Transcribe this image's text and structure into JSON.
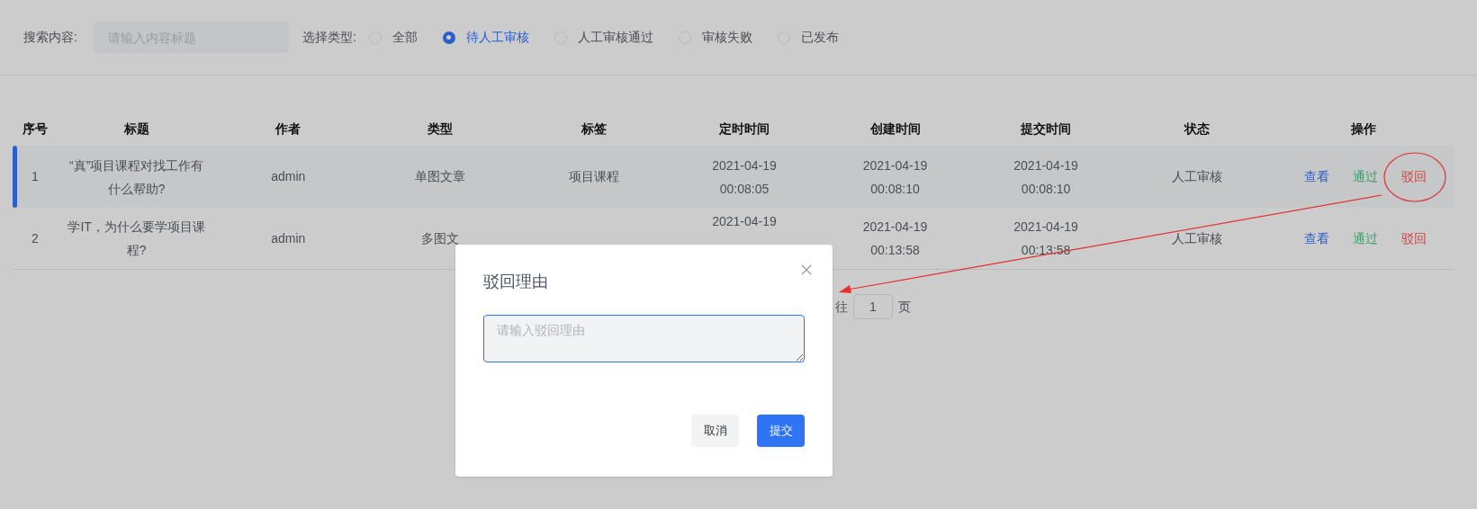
{
  "filter": {
    "search": {
      "label": "搜索内容:",
      "placeholder": "请输入内容标题"
    },
    "type": {
      "label": "选择类型:",
      "options": [
        {
          "label": "全部",
          "selected": false
        },
        {
          "label": "待人工审核",
          "selected": true
        },
        {
          "label": "人工审核通过",
          "selected": false
        },
        {
          "label": "审核失败",
          "selected": false
        },
        {
          "label": "已发布",
          "selected": false
        }
      ]
    }
  },
  "table": {
    "columns": [
      "序号",
      "标题",
      "作者",
      "类型",
      "标签",
      "定时时间",
      "创建时间",
      "提交时间",
      "状态",
      "操作"
    ],
    "rows": [
      {
        "selected": true,
        "index": "1",
        "title": "“真”项目课程对找工作有什么帮助?",
        "author": "admin",
        "type": "单图文章",
        "tag": "项目课程",
        "scheduled": [
          "2021-04-19",
          "00:08:05"
        ],
        "created": [
          "2021-04-19",
          "00:08:10"
        ],
        "submitted": [
          "2021-04-19",
          "00:08:10"
        ],
        "status": "人工审核",
        "actions": [
          {
            "label": "查看",
            "kind": "view"
          },
          {
            "label": "通过",
            "kind": "pass"
          },
          {
            "label": "驳回",
            "kind": "reject"
          }
        ]
      },
      {
        "selected": false,
        "index": "2",
        "title": "学IT，为什么要学项目课程?",
        "author": "admin",
        "type": "多图文",
        "scheduled": [
          "2021-04-19"
        ],
        "created": [
          "2021-04-19",
          "00:13:58"
        ],
        "submitted": [
          "2021-04-19",
          "00:13:58"
        ],
        "status": "人工审核",
        "actions": [
          {
            "label": "查看",
            "kind": "view"
          },
          {
            "label": "通过",
            "kind": "pass"
          },
          {
            "label": "驳回",
            "kind": "reject"
          }
        ]
      }
    ]
  },
  "pagination": {
    "goto_label": "往",
    "page": "1",
    "suffix": "页"
  },
  "dialog": {
    "title": "驳回理由",
    "placeholder": "请输入驳回理由",
    "buttons": [
      {
        "label": "取消",
        "kind": "secondary"
      },
      {
        "label": "提交",
        "kind": "primary"
      }
    ]
  }
}
